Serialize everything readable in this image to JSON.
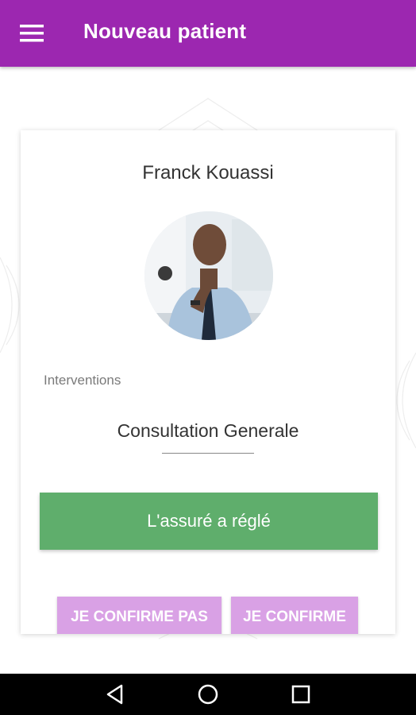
{
  "appbar": {
    "title": "Nouveau patient",
    "menu_icon": "hamburger-menu-icon",
    "color": "#9c27b0"
  },
  "patient": {
    "name": "Franck Kouassi",
    "avatar": "patient-photo"
  },
  "interventions": {
    "label": "Interventions",
    "value": "Consultation Generale"
  },
  "actions": {
    "paid_label": "L'assuré a réglé",
    "paid_color": "#5fae6c",
    "decline_label": "JE CONFIRME PAS",
    "confirm_label": "JE CONFIRME",
    "confirm_color": "#d9a1e5"
  },
  "system_nav": {
    "back_icon": "back-triangle-icon",
    "home_icon": "home-circle-icon",
    "recent_icon": "recent-apps-square-icon"
  }
}
